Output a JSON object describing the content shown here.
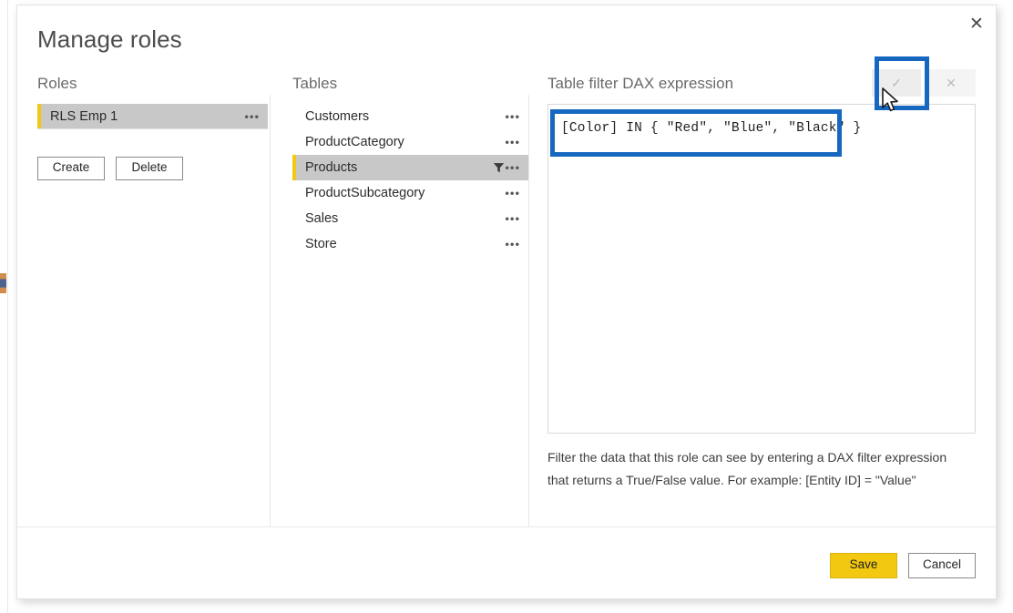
{
  "dialog": {
    "title": "Manage roles",
    "close_label": "✕"
  },
  "roles": {
    "header": "Roles",
    "items": [
      {
        "label": "RLS Emp 1",
        "menu": "•••",
        "selected": true
      }
    ],
    "create_label": "Create",
    "delete_label": "Delete"
  },
  "tables": {
    "header": "Tables",
    "menu_glyph": "•••",
    "items": [
      {
        "label": "Customers",
        "selected": false,
        "filtered": false
      },
      {
        "label": "ProductCategory",
        "selected": false,
        "filtered": false
      },
      {
        "label": "Products",
        "selected": true,
        "filtered": true
      },
      {
        "label": "ProductSubcategory",
        "selected": false,
        "filtered": false
      },
      {
        "label": "Sales",
        "selected": false,
        "filtered": false
      },
      {
        "label": "Store",
        "selected": false,
        "filtered": false
      }
    ]
  },
  "dax": {
    "header": "Table filter DAX expression",
    "accept_label": "✓",
    "cancel_label": "✕",
    "expression": "[Color] IN { \"Red\", \"Blue\", \"Black\" }",
    "help_line_1": "Filter the data that this role can see by entering a DAX filter expression",
    "help_line_2": "that returns a True/False value. For example: [Entity ID] = \"Value\""
  },
  "footer": {
    "save_label": "Save",
    "cancel_label": "Cancel"
  },
  "colors": {
    "accent_yellow": "#F2C811",
    "annotation_blue": "#1567C0",
    "selection_gray": "#C8C8C8"
  }
}
